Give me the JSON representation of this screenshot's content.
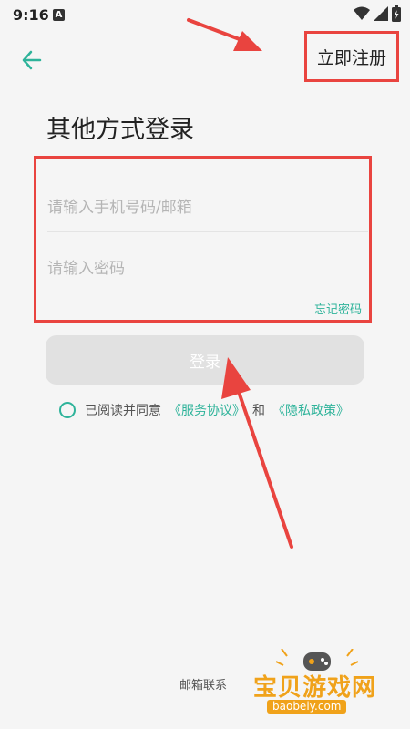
{
  "status_bar": {
    "time": "9:16",
    "notif_badge": "A"
  },
  "header": {
    "register_label": "立即注册"
  },
  "page": {
    "title": "其他方式登录"
  },
  "form": {
    "account_placeholder": "请输入手机号码/邮箱",
    "password_placeholder": "请输入密码",
    "forgot_label": "忘记密码",
    "login_label": "登录"
  },
  "agreement": {
    "prefix": "已阅读并同意",
    "service_link": "《服务协议》",
    "and": "和",
    "privacy_link": "《隐私政策》"
  },
  "footer": {
    "mail_contact": "邮箱联系"
  },
  "watermark": {
    "text": "宝贝游戏网",
    "url": "baobeiy.com"
  },
  "colors": {
    "accent": "#2eb39a",
    "highlight": "#e9443f",
    "background": "#f5f5f5"
  }
}
